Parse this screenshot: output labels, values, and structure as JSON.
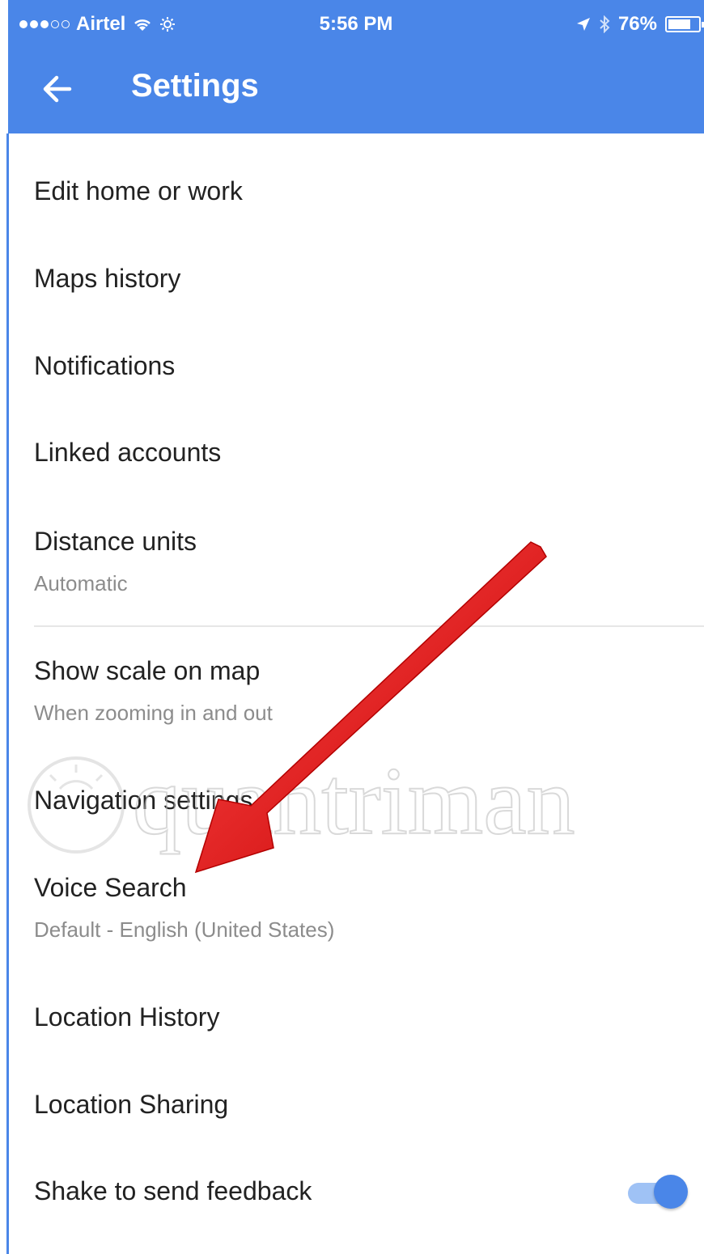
{
  "status_bar": {
    "carrier": "Airtel",
    "time": "5:56 PM",
    "battery": "76%",
    "battery_level": 0.76
  },
  "app_bar": {
    "back_icon": "arrow-back-icon",
    "title": "Settings"
  },
  "settings": {
    "edit_home_or_work": "Edit home or work",
    "maps_history": "Maps history",
    "notifications": "Notifications",
    "linked_accounts": "Linked accounts",
    "distance_units": {
      "title": "Distance units",
      "value": "Automatic"
    },
    "show_scale_on_map": {
      "title": "Show scale on map",
      "value": "When zooming in and out"
    },
    "navigation_settings": "Navigation settings",
    "voice_search": {
      "title": "Voice Search",
      "value": "Default - English (United States)"
    },
    "location_history": "Location History",
    "location_sharing": "Location Sharing",
    "shake_to_send_feedback": {
      "title": "Shake to send feedback",
      "enabled": true
    }
  },
  "colors": {
    "app_bar": "#4a86e8",
    "arrow": "#e31b1b",
    "toggle_on": "#4a86e8"
  },
  "watermark": "quantrimang"
}
